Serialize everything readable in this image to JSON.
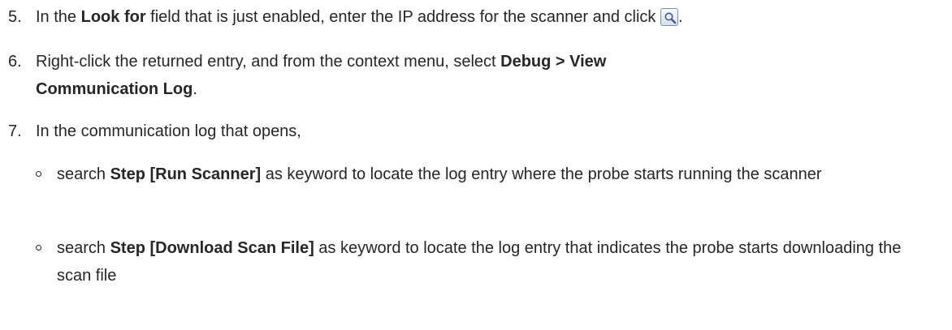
{
  "steps": [
    {
      "number": "5.",
      "t1": "In the ",
      "b1": "Look for",
      "t2": " field that is just enabled, enter the IP address for the scanner and click ",
      "t3": "."
    },
    {
      "number": "6.",
      "t1": "Right-click the returned entry, and from the context menu, select ",
      "b1": "Debug > View Communication Log",
      "t2": "."
    },
    {
      "number": "7.",
      "t1": "In the communication log that opens,",
      "bullets": [
        {
          "t1": "search ",
          "b1": "Step [Run Scanner]",
          "t2": " as keyword to locate the log entry where the probe starts running the scanner"
        },
        {
          "t1": "search ",
          "b1": "Step [Download Scan File]",
          "t2": " as keyword to locate the log entry that indicates the probe starts downloading the scan file"
        }
      ]
    }
  ],
  "icons": {
    "search_button": "magnifier-icon"
  }
}
